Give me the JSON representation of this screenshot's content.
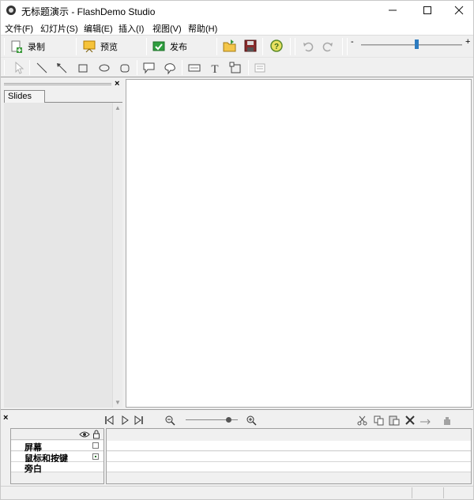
{
  "window": {
    "title": "无标题演示 - FlashDemo Studio",
    "min_glyph": "—",
    "max_glyph": "☐",
    "close_glyph": "✕"
  },
  "menu": [
    "文件(F)",
    "幻灯片(S)",
    "编辑(E)",
    "插入(I)",
    "视图(V)",
    "帮助(H)"
  ],
  "toolbar": {
    "record_label": "录制",
    "preview_label": "预览",
    "publish_label": "发布",
    "zoom_minus": "-",
    "zoom_plus": "+"
  },
  "draw_tools": [
    "select-icon",
    "line-icon",
    "arrow-icon",
    "rectangle-icon",
    "ellipse-icon",
    "rounded-rectangle-icon",
    "callout-icon",
    "cloud-callout-icon",
    "textbox-icon",
    "text-icon",
    "image-frame-icon",
    "note-icon"
  ],
  "left_panel": {
    "close_glyph": "×",
    "tab_label": "Slides",
    "scroll_up": "▲",
    "scroll_down": "▼"
  },
  "timeline": {
    "close_glyph": "×",
    "layers": [
      {
        "name": "屏幕",
        "checked": false
      },
      {
        "name": "鼠标和按键",
        "checked": true
      },
      {
        "name": "旁白",
        "checked": null
      }
    ]
  },
  "colors": {
    "accent": "#2d7bbf",
    "record": "#3a9a3a",
    "preview": "#e8a000",
    "publish": "#2e9e3e"
  }
}
